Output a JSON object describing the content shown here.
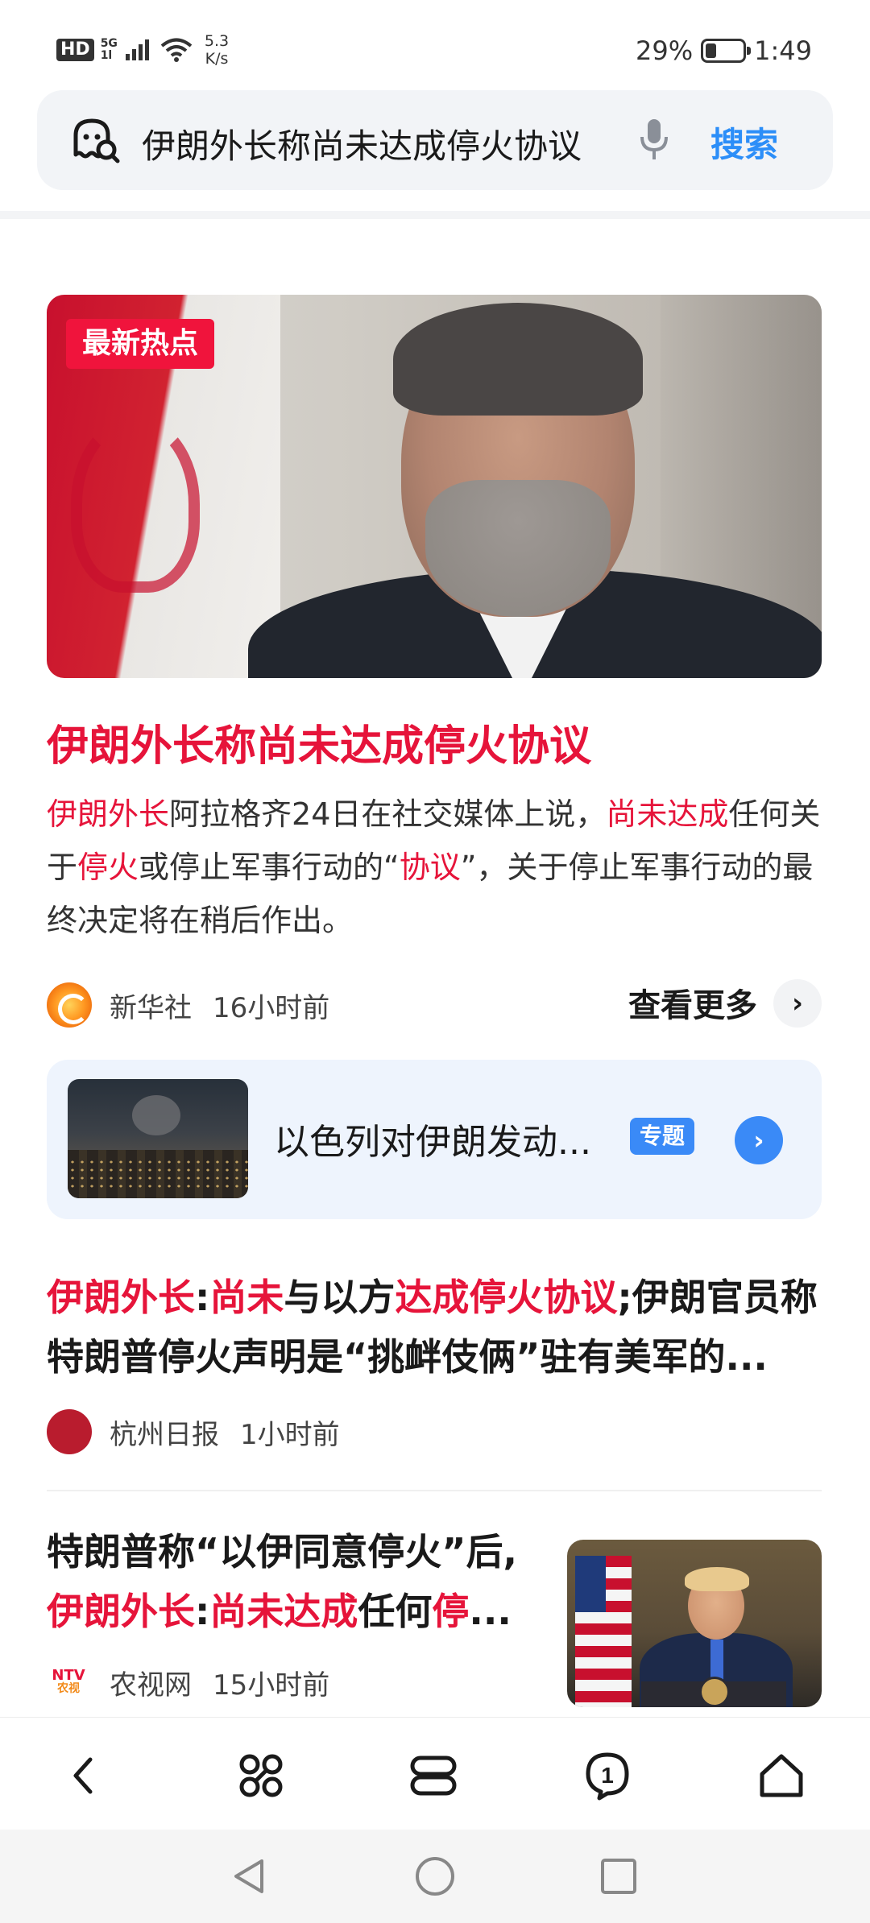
{
  "status_bar": {
    "hd_label": "HD",
    "network_label": "5G",
    "network_sub": "1l",
    "speed_value": "5.3",
    "speed_unit": "K/s",
    "battery_percent": "29%",
    "battery_level": 0.29,
    "time": "1:49"
  },
  "search": {
    "query": "伊朗外长称尚未达成停火协议",
    "button_label": "搜索"
  },
  "hero": {
    "badge": "最新热点",
    "title": "伊朗外长称尚未达成停火协议",
    "summary_parts": {
      "p1": "伊朗外长",
      "p2": "阿拉格齐24日在社交媒体上说，",
      "p3": "尚未达成",
      "p4": "任何关于",
      "p5": "停火",
      "p6": "或停止军事行动的“",
      "p7": "协议",
      "p8": "”，关于停止军事行动的最终决定将在稍后作出。"
    },
    "source": "新华社",
    "time": "16小时前",
    "more_label": "查看更多"
  },
  "topic": {
    "title": "以色列对伊朗发动...",
    "badge": "专题"
  },
  "article2": {
    "title_parts": {
      "p1": "伊朗外长",
      "p2": ":",
      "p3": "尚未",
      "p4": "与以方",
      "p5": "达成停火协议",
      "p6": ";伊朗官员称特朗普停火声明是“挑衅伎俩”驻有美军的..."
    },
    "source": "杭州日报",
    "time": "1小时前"
  },
  "article3": {
    "title_parts": {
      "p1": "特朗普称“以伊同意停火”后,",
      "p2": "伊朗外长",
      "p3": ":",
      "p4": "尚未达成",
      "p5": "任何",
      "p6": "停",
      "p7": "..."
    },
    "source": "农视网",
    "source_logo_top": "NTV",
    "source_logo_bottom": "农视",
    "time": "15小时前"
  },
  "toolbar": {
    "items": [
      "back-icon",
      "apps-icon",
      "tabs-icon",
      "notification-icon",
      "home-icon"
    ],
    "notification_count": "1"
  },
  "colors": {
    "highlight": "#e6143a",
    "accent": "#2c8ef8",
    "topic_bg": "#eef4fd"
  }
}
